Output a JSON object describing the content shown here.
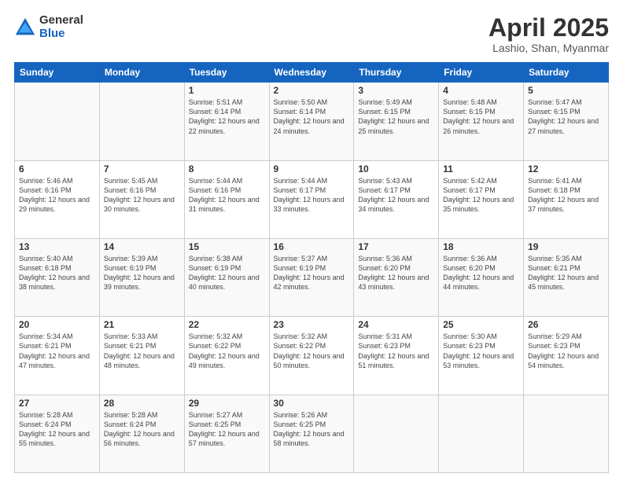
{
  "header": {
    "logo_general": "General",
    "logo_blue": "Blue",
    "title": "April 2025",
    "subtitle": "Lashio, Shan, Myanmar"
  },
  "weekdays": [
    "Sunday",
    "Monday",
    "Tuesday",
    "Wednesday",
    "Thursday",
    "Friday",
    "Saturday"
  ],
  "weeks": [
    [
      {
        "day": "",
        "sunrise": "",
        "sunset": "",
        "daylight": ""
      },
      {
        "day": "",
        "sunrise": "",
        "sunset": "",
        "daylight": ""
      },
      {
        "day": "1",
        "sunrise": "Sunrise: 5:51 AM",
        "sunset": "Sunset: 6:14 PM",
        "daylight": "Daylight: 12 hours and 22 minutes."
      },
      {
        "day": "2",
        "sunrise": "Sunrise: 5:50 AM",
        "sunset": "Sunset: 6:14 PM",
        "daylight": "Daylight: 12 hours and 24 minutes."
      },
      {
        "day": "3",
        "sunrise": "Sunrise: 5:49 AM",
        "sunset": "Sunset: 6:15 PM",
        "daylight": "Daylight: 12 hours and 25 minutes."
      },
      {
        "day": "4",
        "sunrise": "Sunrise: 5:48 AM",
        "sunset": "Sunset: 6:15 PM",
        "daylight": "Daylight: 12 hours and 26 minutes."
      },
      {
        "day": "5",
        "sunrise": "Sunrise: 5:47 AM",
        "sunset": "Sunset: 6:15 PM",
        "daylight": "Daylight: 12 hours and 27 minutes."
      }
    ],
    [
      {
        "day": "6",
        "sunrise": "Sunrise: 5:46 AM",
        "sunset": "Sunset: 6:16 PM",
        "daylight": "Daylight: 12 hours and 29 minutes."
      },
      {
        "day": "7",
        "sunrise": "Sunrise: 5:45 AM",
        "sunset": "Sunset: 6:16 PM",
        "daylight": "Daylight: 12 hours and 30 minutes."
      },
      {
        "day": "8",
        "sunrise": "Sunrise: 5:44 AM",
        "sunset": "Sunset: 6:16 PM",
        "daylight": "Daylight: 12 hours and 31 minutes."
      },
      {
        "day": "9",
        "sunrise": "Sunrise: 5:44 AM",
        "sunset": "Sunset: 6:17 PM",
        "daylight": "Daylight: 12 hours and 33 minutes."
      },
      {
        "day": "10",
        "sunrise": "Sunrise: 5:43 AM",
        "sunset": "Sunset: 6:17 PM",
        "daylight": "Daylight: 12 hours and 34 minutes."
      },
      {
        "day": "11",
        "sunrise": "Sunrise: 5:42 AM",
        "sunset": "Sunset: 6:17 PM",
        "daylight": "Daylight: 12 hours and 35 minutes."
      },
      {
        "day": "12",
        "sunrise": "Sunrise: 5:41 AM",
        "sunset": "Sunset: 6:18 PM",
        "daylight": "Daylight: 12 hours and 37 minutes."
      }
    ],
    [
      {
        "day": "13",
        "sunrise": "Sunrise: 5:40 AM",
        "sunset": "Sunset: 6:18 PM",
        "daylight": "Daylight: 12 hours and 38 minutes."
      },
      {
        "day": "14",
        "sunrise": "Sunrise: 5:39 AM",
        "sunset": "Sunset: 6:19 PM",
        "daylight": "Daylight: 12 hours and 39 minutes."
      },
      {
        "day": "15",
        "sunrise": "Sunrise: 5:38 AM",
        "sunset": "Sunset: 6:19 PM",
        "daylight": "Daylight: 12 hours and 40 minutes."
      },
      {
        "day": "16",
        "sunrise": "Sunrise: 5:37 AM",
        "sunset": "Sunset: 6:19 PM",
        "daylight": "Daylight: 12 hours and 42 minutes."
      },
      {
        "day": "17",
        "sunrise": "Sunrise: 5:36 AM",
        "sunset": "Sunset: 6:20 PM",
        "daylight": "Daylight: 12 hours and 43 minutes."
      },
      {
        "day": "18",
        "sunrise": "Sunrise: 5:36 AM",
        "sunset": "Sunset: 6:20 PM",
        "daylight": "Daylight: 12 hours and 44 minutes."
      },
      {
        "day": "19",
        "sunrise": "Sunrise: 5:35 AM",
        "sunset": "Sunset: 6:21 PM",
        "daylight": "Daylight: 12 hours and 45 minutes."
      }
    ],
    [
      {
        "day": "20",
        "sunrise": "Sunrise: 5:34 AM",
        "sunset": "Sunset: 6:21 PM",
        "daylight": "Daylight: 12 hours and 47 minutes."
      },
      {
        "day": "21",
        "sunrise": "Sunrise: 5:33 AM",
        "sunset": "Sunset: 6:21 PM",
        "daylight": "Daylight: 12 hours and 48 minutes."
      },
      {
        "day": "22",
        "sunrise": "Sunrise: 5:32 AM",
        "sunset": "Sunset: 6:22 PM",
        "daylight": "Daylight: 12 hours and 49 minutes."
      },
      {
        "day": "23",
        "sunrise": "Sunrise: 5:32 AM",
        "sunset": "Sunset: 6:22 PM",
        "daylight": "Daylight: 12 hours and 50 minutes."
      },
      {
        "day": "24",
        "sunrise": "Sunrise: 5:31 AM",
        "sunset": "Sunset: 6:23 PM",
        "daylight": "Daylight: 12 hours and 51 minutes."
      },
      {
        "day": "25",
        "sunrise": "Sunrise: 5:30 AM",
        "sunset": "Sunset: 6:23 PM",
        "daylight": "Daylight: 12 hours and 53 minutes."
      },
      {
        "day": "26",
        "sunrise": "Sunrise: 5:29 AM",
        "sunset": "Sunset: 6:23 PM",
        "daylight": "Daylight: 12 hours and 54 minutes."
      }
    ],
    [
      {
        "day": "27",
        "sunrise": "Sunrise: 5:28 AM",
        "sunset": "Sunset: 6:24 PM",
        "daylight": "Daylight: 12 hours and 55 minutes."
      },
      {
        "day": "28",
        "sunrise": "Sunrise: 5:28 AM",
        "sunset": "Sunset: 6:24 PM",
        "daylight": "Daylight: 12 hours and 56 minutes."
      },
      {
        "day": "29",
        "sunrise": "Sunrise: 5:27 AM",
        "sunset": "Sunset: 6:25 PM",
        "daylight": "Daylight: 12 hours and 57 minutes."
      },
      {
        "day": "30",
        "sunrise": "Sunrise: 5:26 AM",
        "sunset": "Sunset: 6:25 PM",
        "daylight": "Daylight: 12 hours and 58 minutes."
      },
      {
        "day": "",
        "sunrise": "",
        "sunset": "",
        "daylight": ""
      },
      {
        "day": "",
        "sunrise": "",
        "sunset": "",
        "daylight": ""
      },
      {
        "day": "",
        "sunrise": "",
        "sunset": "",
        "daylight": ""
      }
    ]
  ]
}
